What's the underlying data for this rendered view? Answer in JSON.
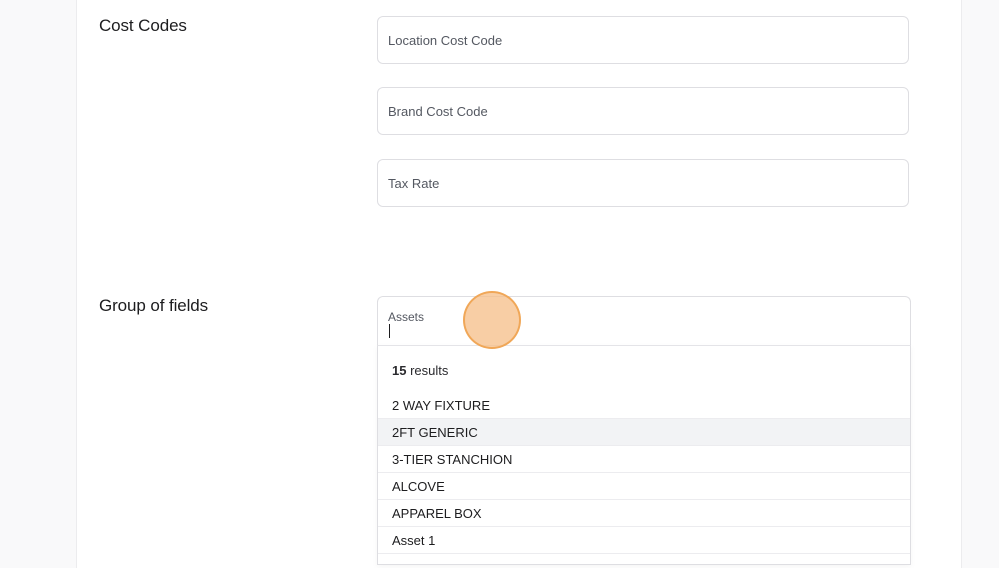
{
  "cost_codes": {
    "title": "Cost Codes",
    "location_placeholder": "Location Cost Code",
    "brand_placeholder": "Brand Cost Code",
    "tax_placeholder": "Tax Rate"
  },
  "group": {
    "title": "Group of fields",
    "combo_label": "Assets",
    "results_count": "15",
    "results_suffix": " results",
    "options": [
      "2 WAY FIXTURE",
      "2FT GENERIC",
      "3-TIER STANCHION",
      "ALCOVE",
      "APPAREL BOX",
      "Asset 1"
    ],
    "highlighted_option": "2FT GENERIC"
  },
  "colors": {
    "cursor_highlight": "#f6be87"
  }
}
